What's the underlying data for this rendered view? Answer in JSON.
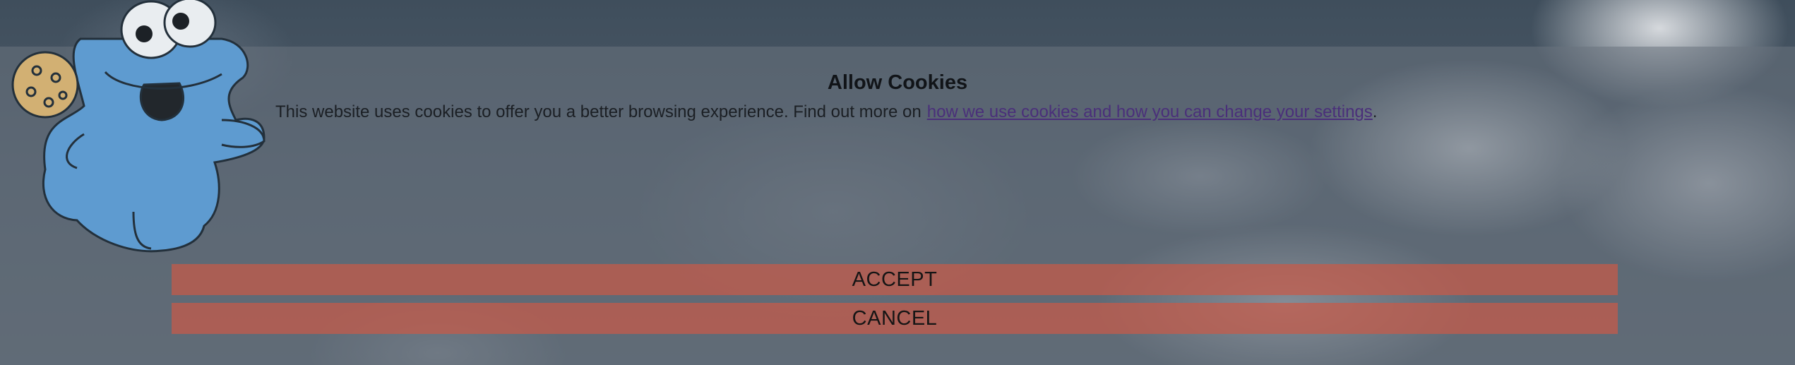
{
  "cookie_banner": {
    "title": "Allow Cookies",
    "message": "This website uses cookies to offer you a better browsing experience. Find out more on",
    "link_text": "how we use cookies and how you can change your settings",
    "link_trailing": ".",
    "accept_label": "ACCEPT",
    "cancel_label": "CANCEL"
  },
  "colors": {
    "overlay": "#69737e",
    "button": "#c85a48",
    "link": "#4a2f7a",
    "mascot_fur": "#5e9bd0",
    "cookie": "#d2b073"
  },
  "icons": {
    "mascot": "cookie-monster-mascot-icon",
    "cookie": "cookie-icon"
  }
}
